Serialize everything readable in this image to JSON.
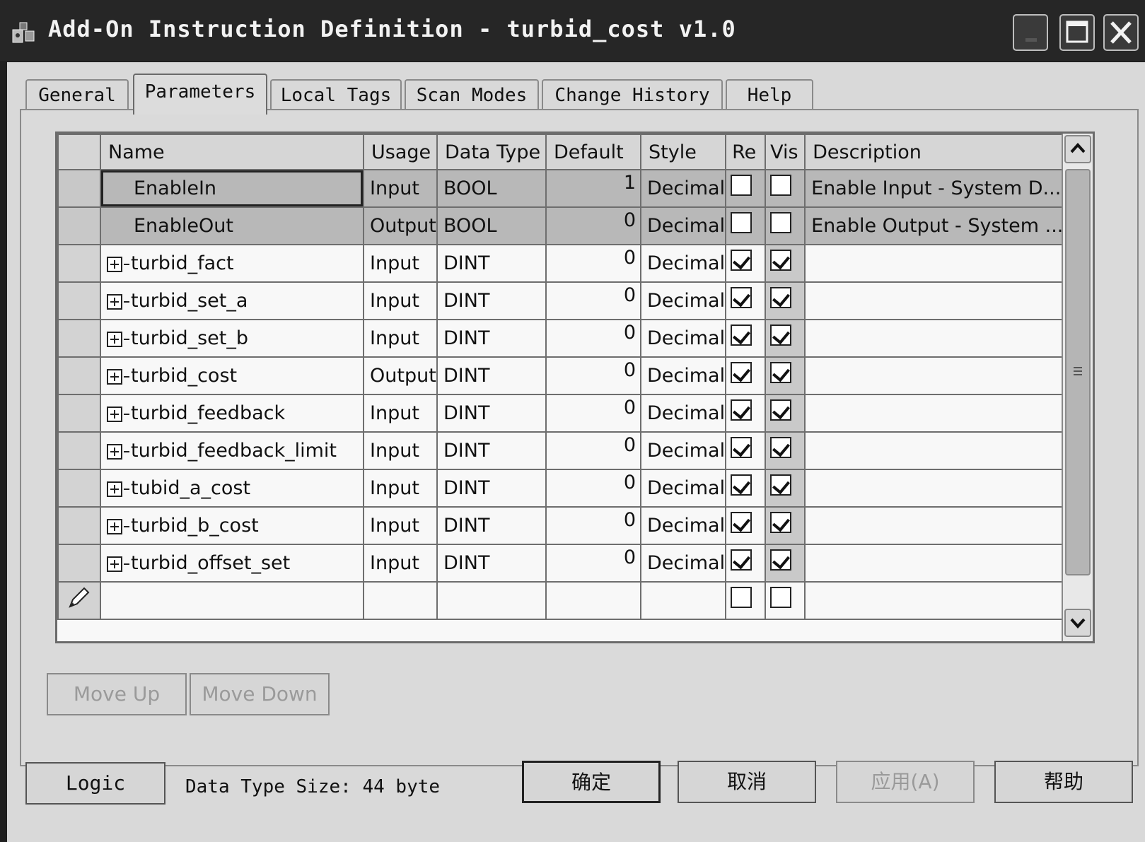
{
  "window": {
    "title": "Add-On Instruction Definition - turbid_cost v1.0"
  },
  "tabs": [
    {
      "label": "General"
    },
    {
      "label": "Parameters"
    },
    {
      "label": "Local Tags"
    },
    {
      "label": "Scan Modes"
    },
    {
      "label": "Change History"
    },
    {
      "label": "Help"
    }
  ],
  "active_tab": "Parameters",
  "grid": {
    "columns": [
      "Name",
      "Usage",
      "Data Type",
      "Default",
      "Style",
      "Re",
      "Vis",
      "Description"
    ],
    "rows": [
      {
        "name": "EnableIn",
        "usage": "Input",
        "data_type": "BOOL",
        "default": "1",
        "style": "Decimal",
        "required": false,
        "visible": false,
        "description": "Enable Input - System D..."
      },
      {
        "name": "EnableOut",
        "usage": "Output",
        "data_type": "BOOL",
        "default": "0",
        "style": "Decimal",
        "required": false,
        "visible": false,
        "description": "Enable Output - System ..."
      },
      {
        "name": "turbid_fact",
        "usage": "Input",
        "data_type": "DINT",
        "default": "0",
        "style": "Decimal",
        "required": true,
        "visible": true,
        "description": ""
      },
      {
        "name": "turbid_set_a",
        "usage": "Input",
        "data_type": "DINT",
        "default": "0",
        "style": "Decimal",
        "required": true,
        "visible": true,
        "description": ""
      },
      {
        "name": "turbid_set_b",
        "usage": "Input",
        "data_type": "DINT",
        "default": "0",
        "style": "Decimal",
        "required": true,
        "visible": true,
        "description": ""
      },
      {
        "name": "turbid_cost",
        "usage": "Output",
        "data_type": "DINT",
        "default": "0",
        "style": "Decimal",
        "required": true,
        "visible": true,
        "description": ""
      },
      {
        "name": "turbid_feedback",
        "usage": "Input",
        "data_type": "DINT",
        "default": "0",
        "style": "Decimal",
        "required": true,
        "visible": true,
        "description": ""
      },
      {
        "name": "turbid_feedback_limit",
        "usage": "Input",
        "data_type": "DINT",
        "default": "0",
        "style": "Decimal",
        "required": true,
        "visible": true,
        "description": ""
      },
      {
        "name": "tubid_a_cost",
        "usage": "Input",
        "data_type": "DINT",
        "default": "0",
        "style": "Decimal",
        "required": true,
        "visible": true,
        "description": ""
      },
      {
        "name": "turbid_b_cost",
        "usage": "Input",
        "data_type": "DINT",
        "default": "0",
        "style": "Decimal",
        "required": true,
        "visible": true,
        "description": ""
      },
      {
        "name": "turbid_offset_set",
        "usage": "Input",
        "data_type": "DINT",
        "default": "0",
        "style": "Decimal",
        "required": true,
        "visible": true,
        "description": ""
      }
    ],
    "new_row": {
      "required": false,
      "visible": false
    }
  },
  "buttons": {
    "move_up": "Move Up",
    "move_down": "Move Down",
    "logic": "Logic",
    "ok": "确定",
    "cancel": "取消",
    "apply": "应用(A)",
    "help": "帮助"
  },
  "status": {
    "data_type_size": "Data Type Size: 44 byte"
  },
  "icons": {
    "app": "add-on-instruction-icon",
    "new_row": "pencil-icon",
    "expand": "plus-box-icon"
  }
}
